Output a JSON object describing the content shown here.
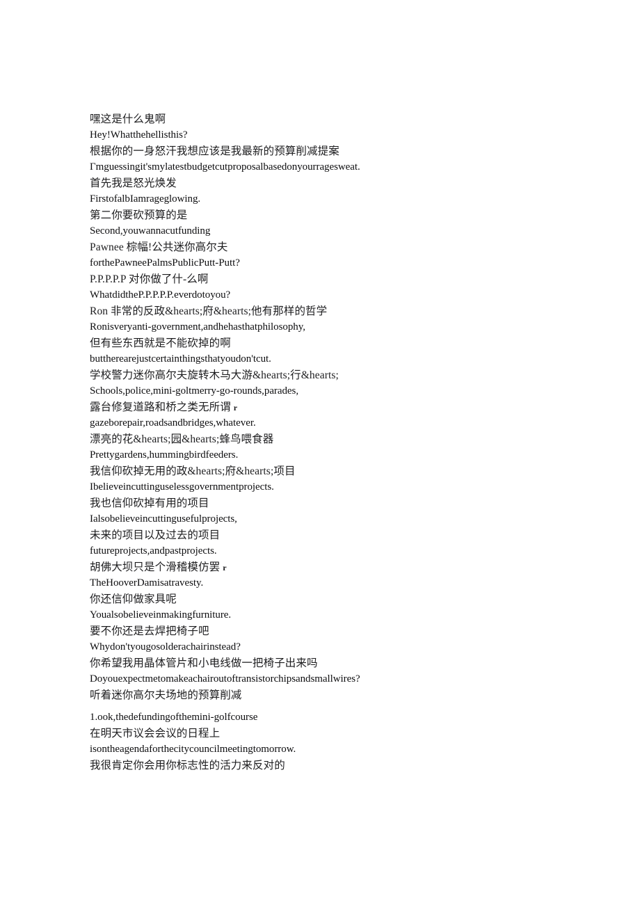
{
  "document": {
    "background_color": "#ffffff",
    "text_color": "#111111",
    "type": "bilingual-subtitle-transcript",
    "lines": [
      {
        "id": "l01",
        "lang": "zh",
        "text": "嘿这是什么鬼啊"
      },
      {
        "id": "l02",
        "lang": "en",
        "text": "Hey!Whatthehellisthis?"
      },
      {
        "id": "l03",
        "lang": "zh",
        "text": "根据你的一身怒汗我想应该是我最新的预算削减提案"
      },
      {
        "id": "l04",
        "lang": "en",
        "text": "Γmguessingit'smylatestbudgetcutproposalbasedonyourragesweat."
      },
      {
        "id": "l05",
        "lang": "zh",
        "text": "首先我是怒光焕发"
      },
      {
        "id": "l06",
        "lang": "en",
        "text": "FirstofalbIamrageglowing."
      },
      {
        "id": "l07",
        "lang": "zh",
        "text": "第二你要砍预算的是"
      },
      {
        "id": "l08",
        "lang": "en",
        "text": "Second,youwannacutfunding"
      },
      {
        "id": "l09",
        "lang": "zh",
        "text": "Pawnee 棕幅!公共迷你高尔夫"
      },
      {
        "id": "l10",
        "lang": "en",
        "text": "forthePawneePalmsPublicPutt-Putt?"
      },
      {
        "id": "l11",
        "lang": "zh",
        "text": "P.P.P.P.P 对你做了什-么啊"
      },
      {
        "id": "l12",
        "lang": "en",
        "text": "WhatdidtheP.P.P.P.P.everdotoyou?"
      },
      {
        "id": "l13",
        "lang": "zh",
        "text": "Ron 非常的反政&hearts;府&hearts;他有那样的哲学"
      },
      {
        "id": "l14",
        "lang": "en",
        "text": "Ronisveryanti-government,andhehasthatphilosophy,"
      },
      {
        "id": "l15",
        "lang": "zh",
        "text": "但有些东西就是不能砍掉的啊"
      },
      {
        "id": "l16",
        "lang": "en",
        "text": "buttherearejustcertainthingsthatyoudon'tcut."
      },
      {
        "id": "l17",
        "lang": "zh",
        "text": "学校警力迷你高尔夫旋转木马大游&hearts;行&hearts;"
      },
      {
        "id": "l18",
        "lang": "en",
        "text": "Schools,police,mini-goltmerry-go-rounds,parades,"
      },
      {
        "id": "l19",
        "lang": "zh",
        "text": "露台修复道路和桥之类无所谓",
        "artifact": "r"
      },
      {
        "id": "l20",
        "lang": "en",
        "text": "gazeborepair,roadsandbridges,whatever."
      },
      {
        "id": "l21",
        "lang": "zh",
        "text": "漂亮的花&hearts;园&hearts;蜂鸟喂食器"
      },
      {
        "id": "l22",
        "lang": "en",
        "text": "Prettygardens,hummingbirdfeeders."
      },
      {
        "id": "l23",
        "lang": "zh",
        "text": "我信仰砍掉无用的政&hearts;府&hearts;项目"
      },
      {
        "id": "l24",
        "lang": "en",
        "text": "Ibelieveincuttinguselessgovernmentprojects."
      },
      {
        "id": "l25",
        "lang": "zh",
        "text": "我也信仰砍掉有用的项目"
      },
      {
        "id": "l26",
        "lang": "en",
        "text": "Ialsobelieveincuttingusefulprojects,"
      },
      {
        "id": "l27",
        "lang": "zh",
        "text": "未来的项目以及过去的项目"
      },
      {
        "id": "l28",
        "lang": "en",
        "text": "futureprojects,andpastprojects."
      },
      {
        "id": "l29",
        "lang": "zh",
        "text": "胡佛大坝只是个滑稽模仿罢",
        "artifact": "r"
      },
      {
        "id": "l30",
        "lang": "en",
        "text": "TheHooverDamisatravesty."
      },
      {
        "id": "l31",
        "lang": "zh",
        "text": "你还信仰做家具呢"
      },
      {
        "id": "l32",
        "lang": "en",
        "text": "Youalsobelieveinmakingfurniture."
      },
      {
        "id": "l33",
        "lang": "zh",
        "text": "要不你还是去焊把椅子吧"
      },
      {
        "id": "l34",
        "lang": "en",
        "text": "Whydon'tyougosolderachairinstead?"
      },
      {
        "id": "l35",
        "lang": "zh",
        "text": "你希望我用晶体管片和小电线做一把椅子出来吗"
      },
      {
        "id": "l36",
        "lang": "en",
        "text": "Doyouexpectmetomakeachairoutoftransistorchipsandsmallwires?"
      },
      {
        "id": "l37",
        "lang": "zh",
        "text": "听着迷你高尔夫场地的预算削减"
      },
      {
        "id": "l38",
        "lang": "en",
        "text": "1.ook,thedefundingofthemini-golfcourse",
        "gap_before": true
      },
      {
        "id": "l39",
        "lang": "zh",
        "text": "在明天市议会会议的日程上"
      },
      {
        "id": "l40",
        "lang": "en",
        "text": "isontheagendaforthecitycouncilmeetingtomorrow."
      },
      {
        "id": "l41",
        "lang": "zh",
        "text": "我很肯定你会用你标志性的活力来反对的"
      }
    ]
  }
}
